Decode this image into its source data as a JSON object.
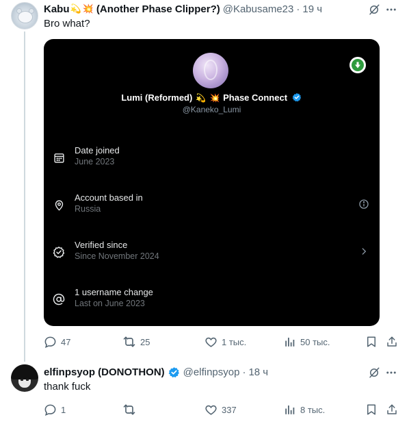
{
  "tweet1": {
    "display_name_a": "Kabu",
    "emoji_a": "💫",
    "emoji_b": "💥",
    "display_name_b": "(Another Phase Clipper?)",
    "handle": "@Kabusame23",
    "separator": "·",
    "time": "19 ч",
    "text": "Bro what?",
    "card": {
      "name_a": "Lumi (Reformed)",
      "emoji_a": "💫",
      "emoji_b": "💥",
      "name_b": "Phase Connect",
      "handle": "@Kaneko_Lumi",
      "rows": [
        {
          "title": "Date joined",
          "subtitle": "June 2023",
          "icon": "calendar-icon"
        },
        {
          "title": "Account based in",
          "subtitle": "Russia",
          "icon": "location-pin-icon"
        },
        {
          "title": "Verified since",
          "subtitle": "Since November 2024",
          "icon": "verified-check-icon"
        },
        {
          "title": "1 username change",
          "subtitle": "Last on June 2023",
          "icon": "at-sign-icon"
        }
      ]
    },
    "actions": {
      "replies": "47",
      "reposts": "25",
      "likes": "1 тыс.",
      "views": "50 тыс."
    }
  },
  "tweet2": {
    "display_name": "elfinpsyop (DONOTHON)",
    "handle": "@elfinpsyop",
    "separator": "·",
    "time": "18 ч",
    "text": "thank fuck",
    "actions": {
      "replies": "1",
      "reposts": "",
      "likes": "337",
      "views": "8 тыс."
    }
  },
  "colors": {
    "verified_blue": "#1d9bf0",
    "muted_text": "#536471",
    "card_bg": "#000000",
    "download_green": "#2e9b3e"
  }
}
